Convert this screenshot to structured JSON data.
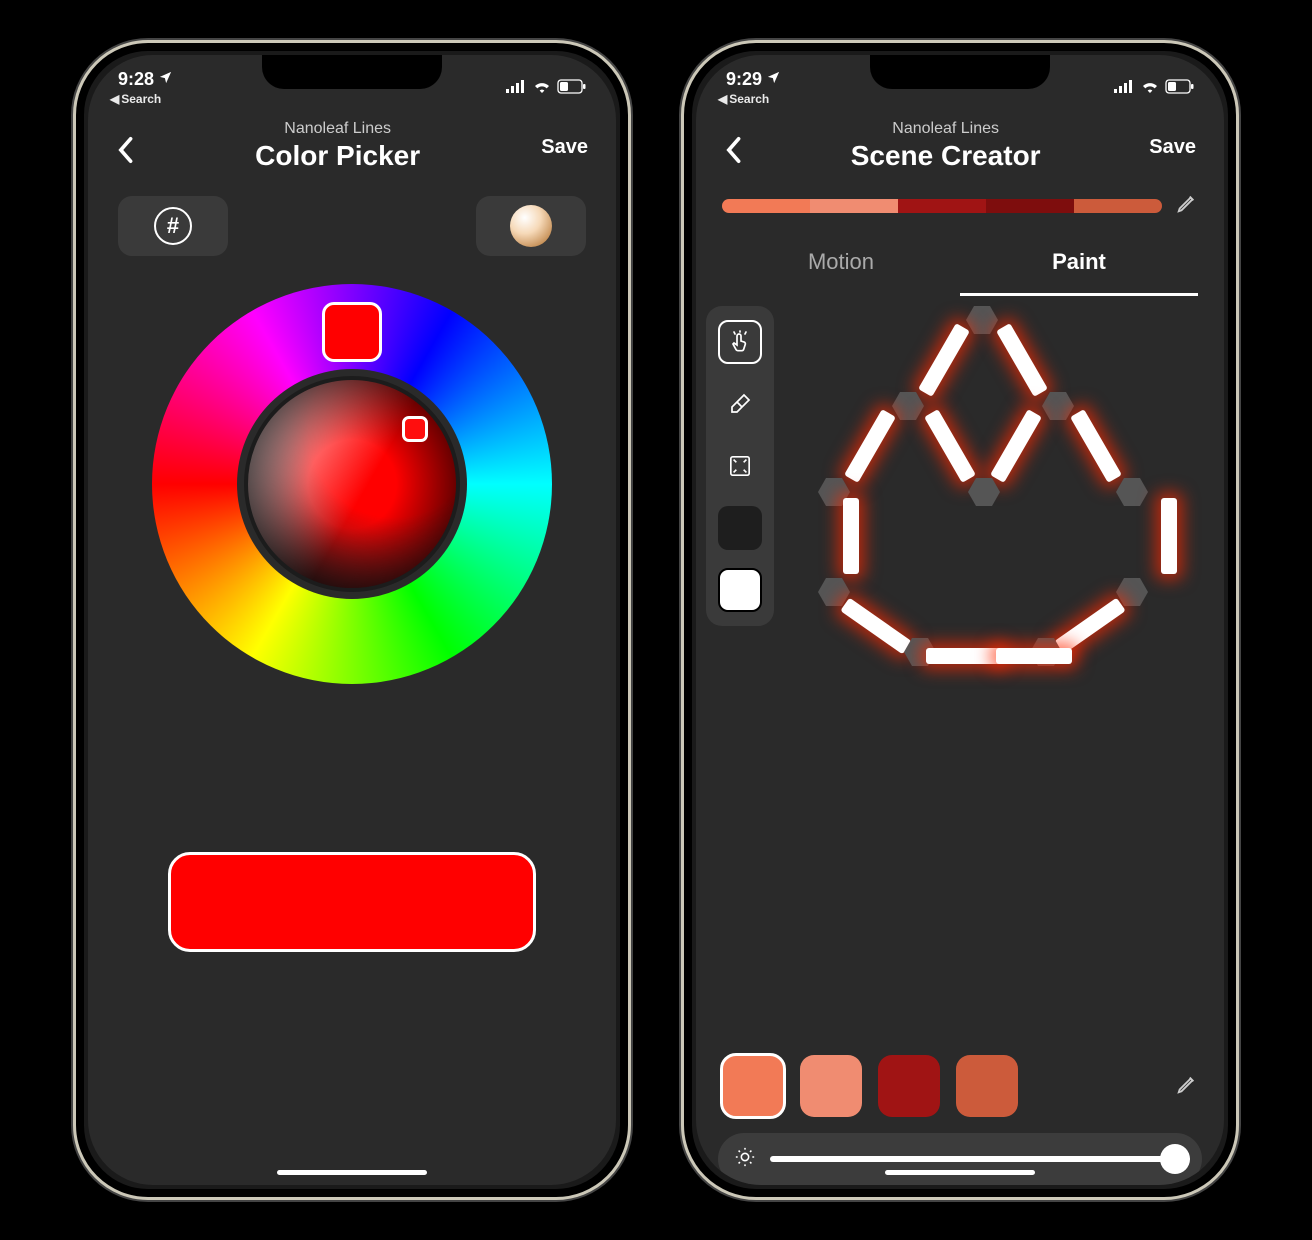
{
  "left": {
    "status": {
      "time": "9:28",
      "back_app": "Search"
    },
    "header": {
      "subtitle": "Nanoleaf Lines",
      "title": "Color Picker",
      "save": "Save"
    },
    "picker": {
      "hex_symbol": "#",
      "selected_hue_color": "#ff0000",
      "selected_sat_color": "#ff0e0e",
      "result_color": "#ff0000"
    }
  },
  "right": {
    "status": {
      "time": "9:29",
      "back_app": "Search"
    },
    "header": {
      "subtitle": "Nanoleaf Lines",
      "title": "Scene Creator",
      "save": "Save"
    },
    "palette_strip": [
      "#f27a56",
      "#f08c71",
      "#a01414",
      "#7e0d0d",
      "#cc5b3b"
    ],
    "tabs": {
      "motion": "Motion",
      "paint": "Paint",
      "active": "paint"
    },
    "toolbar": {
      "tools": [
        "finger-tap-icon",
        "eraser-icon",
        "expand-icon"
      ],
      "tool_swatches": [
        "#1e1e1e",
        "#ffffff"
      ]
    },
    "glow_color": "#ff2a00",
    "swatches": [
      "#f27a56",
      "#f08c71",
      "#a01414",
      "#cc5b3b"
    ],
    "selected_swatch_index": 0,
    "brightness": {
      "value_percent": 100
    }
  },
  "status_icons": {
    "location": "location-icon",
    "signal": "signal-icon",
    "wifi": "wifi-icon",
    "battery": "battery-icon"
  }
}
